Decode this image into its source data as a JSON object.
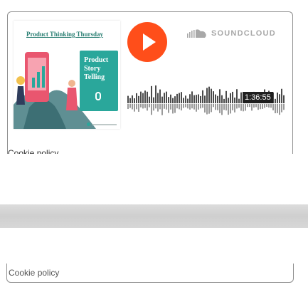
{
  "widget": {
    "artwork": {
      "title": "Product Thinking Thursday",
      "card_text": "Product\nStory\nTelling"
    },
    "brand_label": "SOUNDCLOUD",
    "icons": {
      "play": "play-icon",
      "brand": "soundcloud-cloud-icon",
      "mic": "microphone-icon"
    },
    "duration": "1:36:55",
    "cookie_label": "Cookie policy",
    "colors": {
      "play": "#ff4e1a",
      "waveform": "#4a4a4a",
      "card": "#2aa79b"
    }
  },
  "second_widget": {
    "cookie_label": "Cookie policy"
  }
}
